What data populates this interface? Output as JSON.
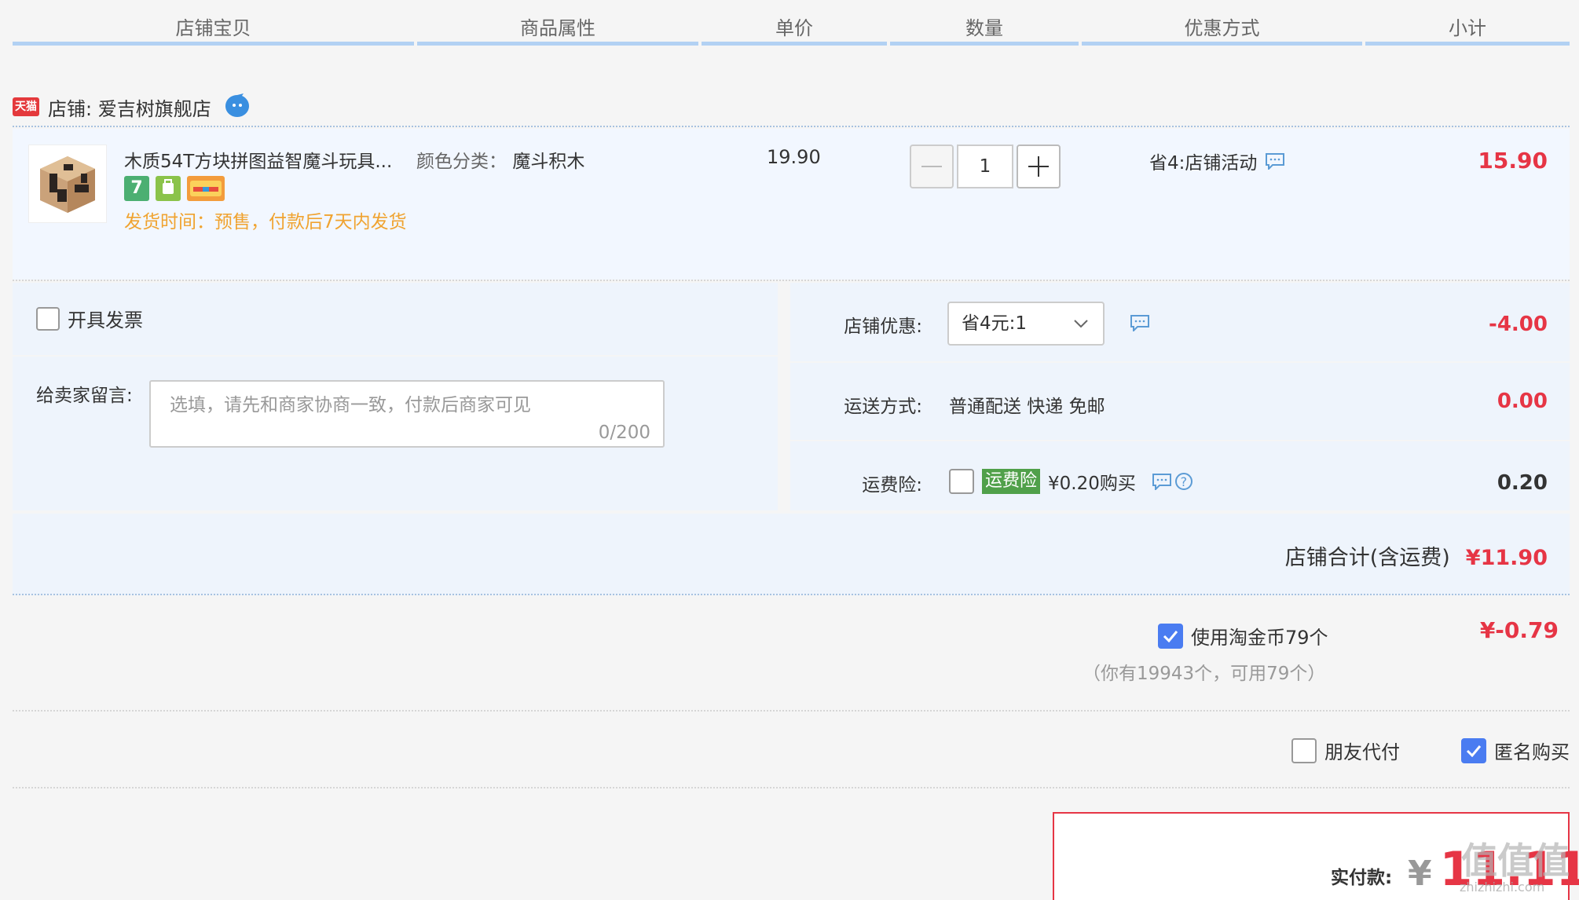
{
  "columns": [
    {
      "label": "店铺宝贝"
    },
    {
      "label": "商品属性"
    },
    {
      "label": "单价"
    },
    {
      "label": "数量"
    },
    {
      "label": "优惠方式"
    },
    {
      "label": "小计"
    }
  ],
  "shop": {
    "badge": "天猫",
    "name": "店铺: 爱吉树旗舰店"
  },
  "item": {
    "title": "木质54T方块拼图益智魔斗玩具...",
    "ship_time": "发货时间：预售，付款后7天内发货",
    "attr_label": "颜色分类：",
    "attr_value": "魔斗积木",
    "price": "19.90",
    "qty": "1",
    "promo": "省4:店铺活动",
    "subtotal": "15.90",
    "icon_seven": "7"
  },
  "invoice": {
    "label": "开具发票",
    "checked": false
  },
  "message": {
    "label": "给卖家留言:",
    "placeholder": "选填，请先和商家协商一致，付款后商家可见",
    "count": "0/200"
  },
  "discount": {
    "label": "店铺优惠:",
    "selected": "省4元:1",
    "amount": "-4.00"
  },
  "shipping": {
    "label": "运送方式:",
    "value": "普通配送 快递 免邮",
    "amount": "0.00"
  },
  "insurance": {
    "label": "运费险:",
    "tag": "运费险",
    "text": "¥0.20购买",
    "amount": "0.20",
    "help": "?"
  },
  "shop_total": {
    "label": "店铺合计(含运费)",
    "amount": "¥11.90"
  },
  "coins": {
    "label": "使用淘金币79个",
    "sub": "（你有19943个，可用79个）",
    "amount": "¥-0.79",
    "checked": true
  },
  "options": {
    "friend_pay": "朋友代付",
    "anonymous": "匿名购买"
  },
  "payment": {
    "label": "实付款:",
    "currency": "¥",
    "amount": "11.11"
  },
  "watermark": {
    "main": "值值值",
    "sub": "zhizhizhi.com"
  },
  "colors": {
    "accent_red": "#e63545",
    "checkbox_blue": "#4a7cf1",
    "header_line": "#b2d1f3",
    "ship_orange": "#f0a330",
    "insurance_green": "#50a04a"
  }
}
